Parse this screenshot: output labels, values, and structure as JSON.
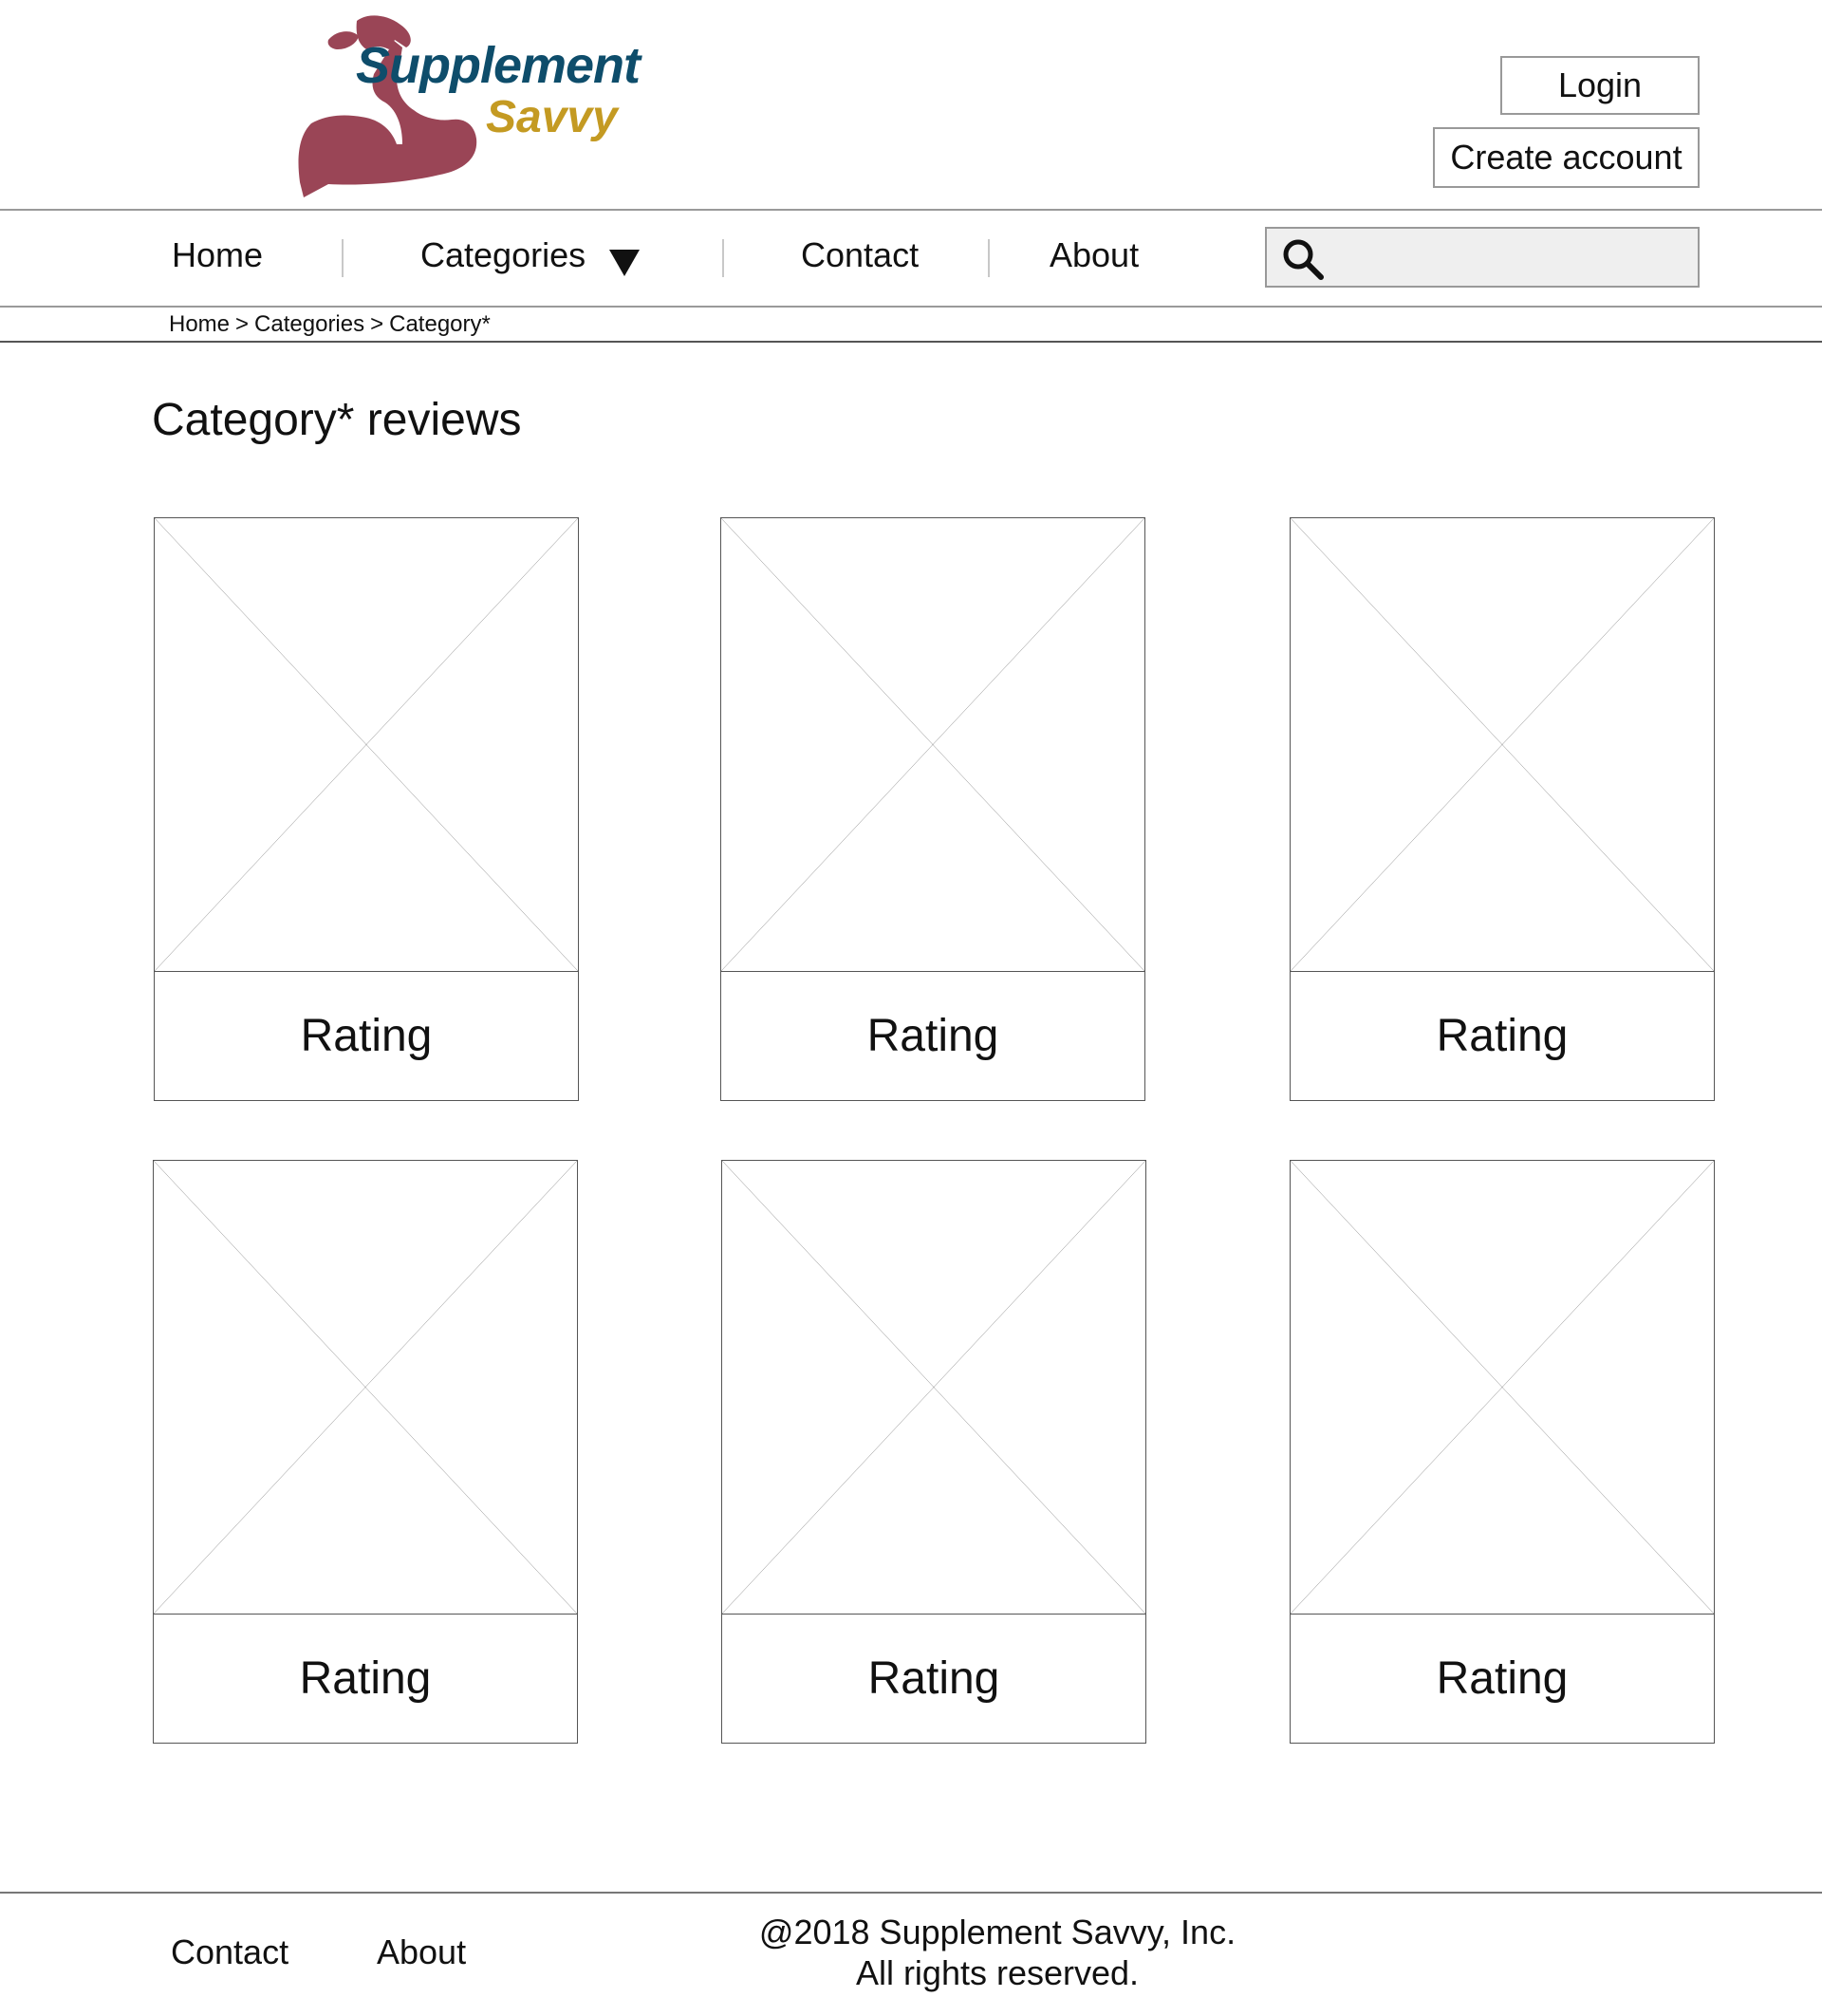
{
  "brand": {
    "word1": "Supplement",
    "word2": "Savvy",
    "colors": {
      "primary": "#0e4d6b",
      "secondary": "#c49a22",
      "icon": "#9a4556"
    }
  },
  "header": {
    "login_label": "Login",
    "create_account_label": "Create account"
  },
  "nav": {
    "home": "Home",
    "categories": "Categories",
    "contact": "Contact",
    "about": "About"
  },
  "search": {
    "placeholder": "",
    "value": ""
  },
  "breadcrumb": {
    "items": [
      "Home",
      "Categories",
      "Category*"
    ],
    "separator": ">"
  },
  "page_title": "Category* reviews",
  "cards": [
    {
      "rating_label": "Rating"
    },
    {
      "rating_label": "Rating"
    },
    {
      "rating_label": "Rating"
    },
    {
      "rating_label": "Rating"
    },
    {
      "rating_label": "Rating"
    },
    {
      "rating_label": "Rating"
    }
  ],
  "footer": {
    "contact": "Contact",
    "about": "About",
    "copyright_line1": "@2018 Supplement Savvy, Inc.",
    "copyright_line2": "All rights reserved."
  }
}
